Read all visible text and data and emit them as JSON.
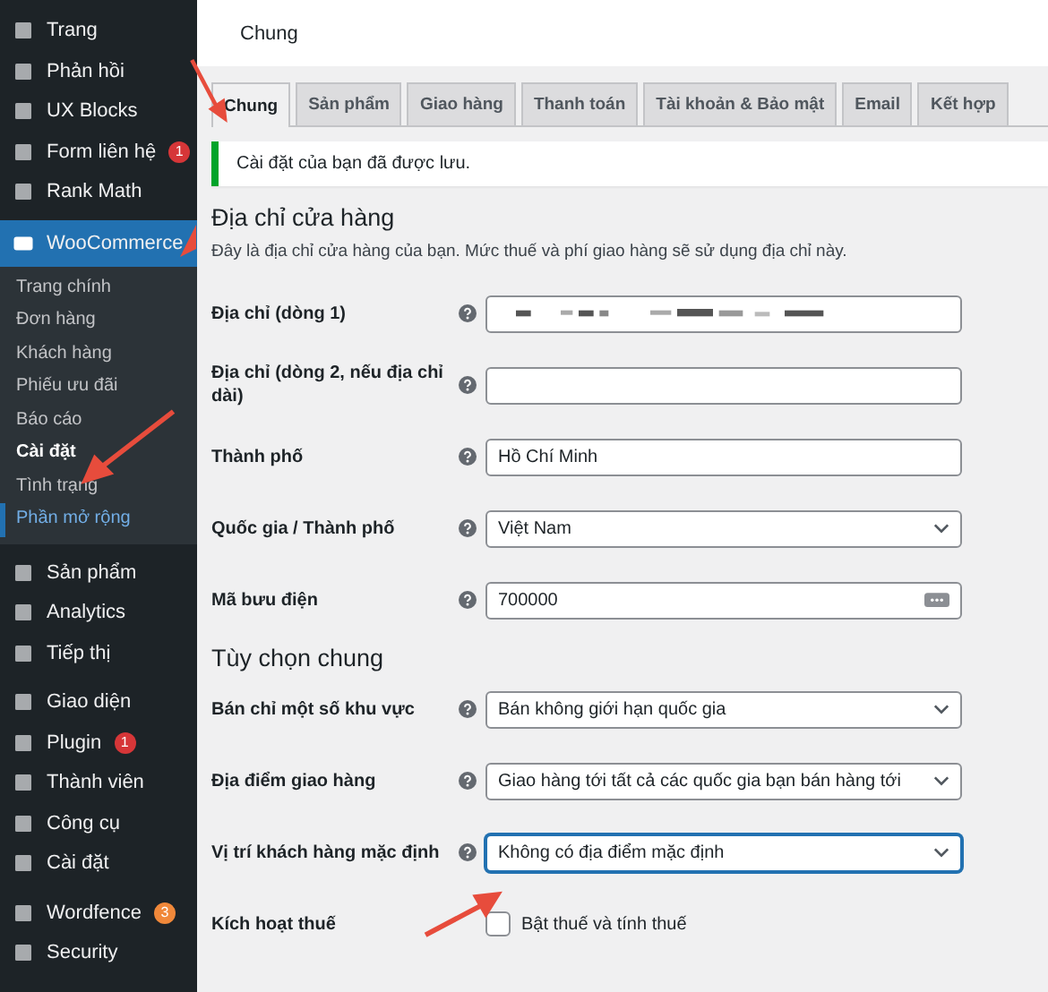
{
  "sidebar": {
    "groups": [
      {
        "items": [
          {
            "label": "Trang",
            "selected": false
          },
          {
            "label": "Phản hồi",
            "selected": false
          },
          {
            "label": "UX Blocks",
            "selected": false
          },
          {
            "label": "Form liên hệ",
            "badge": "1",
            "color": "#d63638",
            "selected": false
          },
          {
            "label": "Rank Math",
            "selected": false
          },
          {
            "label": "WooCommerce",
            "selected": true,
            "children": [
              {
                "label": "Trang chính",
                "selected": false,
                "hovered": false
              },
              {
                "label": "Đơn hàng",
                "selected": false,
                "hovered": false
              },
              {
                "label": "Khách hàng",
                "selected": false,
                "hovered": false
              },
              {
                "label": "Phiếu ưu đãi",
                "selected": false,
                "hovered": false
              },
              {
                "label": "Báo cáo",
                "selected": false,
                "hovered": false
              },
              {
                "label": "Cài đặt",
                "selected": true,
                "hovered": false
              },
              {
                "label": "Tình trạng",
                "selected": false,
                "hovered": false
              },
              {
                "label": "Phần mở rộng",
                "selected": false,
                "hovered": true
              }
            ]
          }
        ]
      },
      {
        "items": [
          {
            "label": "Sản phẩm",
            "selected": false
          },
          {
            "label": "Analytics",
            "selected": false
          },
          {
            "label": "Tiếp thị",
            "selected": false
          }
        ]
      },
      {
        "items": [
          {
            "label": "Giao diện",
            "selected": false
          },
          {
            "label": "Plugin",
            "badge": "1",
            "color": "#d63638",
            "selected": false
          },
          {
            "label": "Thành viên",
            "selected": false
          },
          {
            "label": "Công cụ",
            "selected": false
          },
          {
            "label": "Cài đặt",
            "selected": false
          }
        ]
      },
      {
        "items": [
          {
            "label": "Wordfence",
            "badge": "3",
            "color": "#f0883a",
            "selected": false
          },
          {
            "label": "Security",
            "selected": false
          }
        ]
      }
    ]
  },
  "header": {
    "title": "Chung"
  },
  "tabs": [
    {
      "label": "Chung",
      "selected": true
    },
    {
      "label": "Sản phẩm",
      "selected": false
    },
    {
      "label": "Giao hàng",
      "selected": false
    },
    {
      "label": "Thanh toán",
      "selected": false
    },
    {
      "label": "Tài khoản & Bảo mật",
      "selected": false
    },
    {
      "label": "Email",
      "selected": false
    },
    {
      "label": "Kết hợp",
      "selected": false
    }
  ],
  "notice": "Cài đặt của bạn đã được lưu.",
  "sections": [
    {
      "title": "Địa chỉ cửa hàng",
      "description": "Đây là địa chỉ cửa hàng của bạn. Mức thuế và phí giao hàng sẽ sử dụng địa chỉ này.",
      "fields": [
        {
          "kind": "text",
          "label": "Địa chỉ (dòng 1)",
          "redacted": true
        },
        {
          "kind": "text",
          "label": "Địa chỉ (dòng 2, nếu địa chỉ dài)"
        },
        {
          "kind": "text",
          "label": "Thành phố",
          "value": "Hồ Chí Minh"
        },
        {
          "kind": "select",
          "label": "Quốc gia / Thành phố",
          "value": "Việt Nam",
          "focused": false
        },
        {
          "kind": "text",
          "label": "Mã bưu điện",
          "value": "700000",
          "autofill_icon": true
        }
      ]
    },
    {
      "title": "Tùy chọn chung",
      "fields": [
        {
          "kind": "select",
          "label": "Bán chỉ một số khu vực",
          "value": "Bán không giới hạn quốc gia",
          "focused": false
        },
        {
          "kind": "select",
          "label": "Địa điểm giao hàng",
          "value": "Giao hàng tới tất cả các quốc gia bạn bán hàng tới",
          "focused": false
        },
        {
          "kind": "select",
          "label": "Vị trí khách hàng mặc định",
          "value": "Không có địa điểm mặc định",
          "focused": true
        },
        {
          "kind": "checkbox",
          "label": "Kích hoạt thuế",
          "value": "Bật thuế và tính thuế",
          "checked": false
        }
      ]
    }
  ]
}
